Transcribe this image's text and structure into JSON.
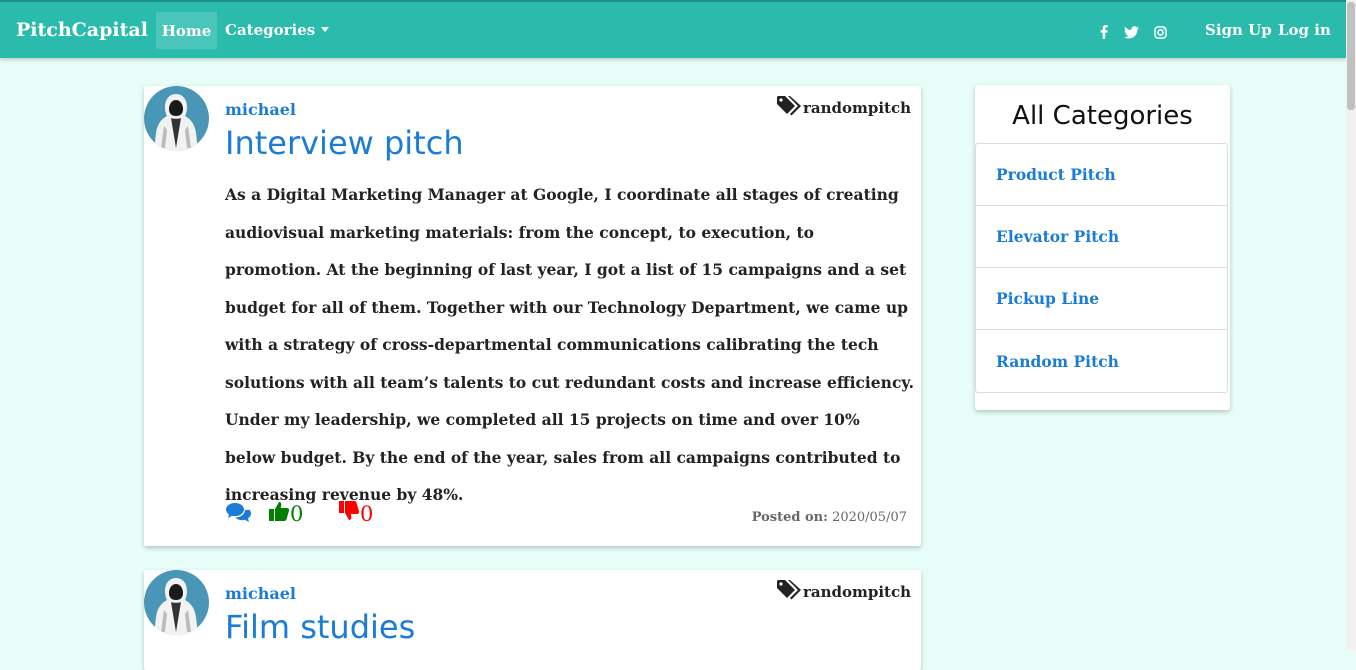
{
  "navbar": {
    "brand": "PitchCapital",
    "home": "Home",
    "categories": "Categories",
    "social_icons": [
      "facebook-icon",
      "twitter-icon",
      "instagram-icon"
    ],
    "signup": "Sign Up",
    "login": "Log in"
  },
  "posts": [
    {
      "author": "michael",
      "tag": "randompitch",
      "title": "Interview pitch",
      "body": "As a Digital Marketing Manager at Google, I coordinate all stages of creating audiovisual marketing materials: from the concept, to execution, to promotion. At the beginning of last year, I got a list of 15 campaigns and a set budget for all of them. Together with our Technology Department, we came up with a strategy of cross-departmental communications calibrating the tech solutions with all team’s talents to cut redundant costs and increase efficiency. Under my leadership, we completed all 15 projects on time and over 10% below budget. By the end of the year, sales from all campaigns contributed to increasing revenue by 48%.",
      "likes": "0",
      "dislikes": "0",
      "posted_label": "Posted on:",
      "posted_date": "2020/05/07"
    },
    {
      "author": "michael",
      "tag": "randompitch",
      "title": "Film studies"
    }
  ],
  "sidebar": {
    "title": "All Categories",
    "items": [
      "Product Pitch",
      "Elevator Pitch",
      "Pickup Line",
      "Random Pitch"
    ]
  },
  "colors": {
    "navbar": "#2bbbad",
    "background": "#e6fdf8",
    "link": "#1a7cd6",
    "like": "#008000",
    "dislike": "#ff0000"
  }
}
